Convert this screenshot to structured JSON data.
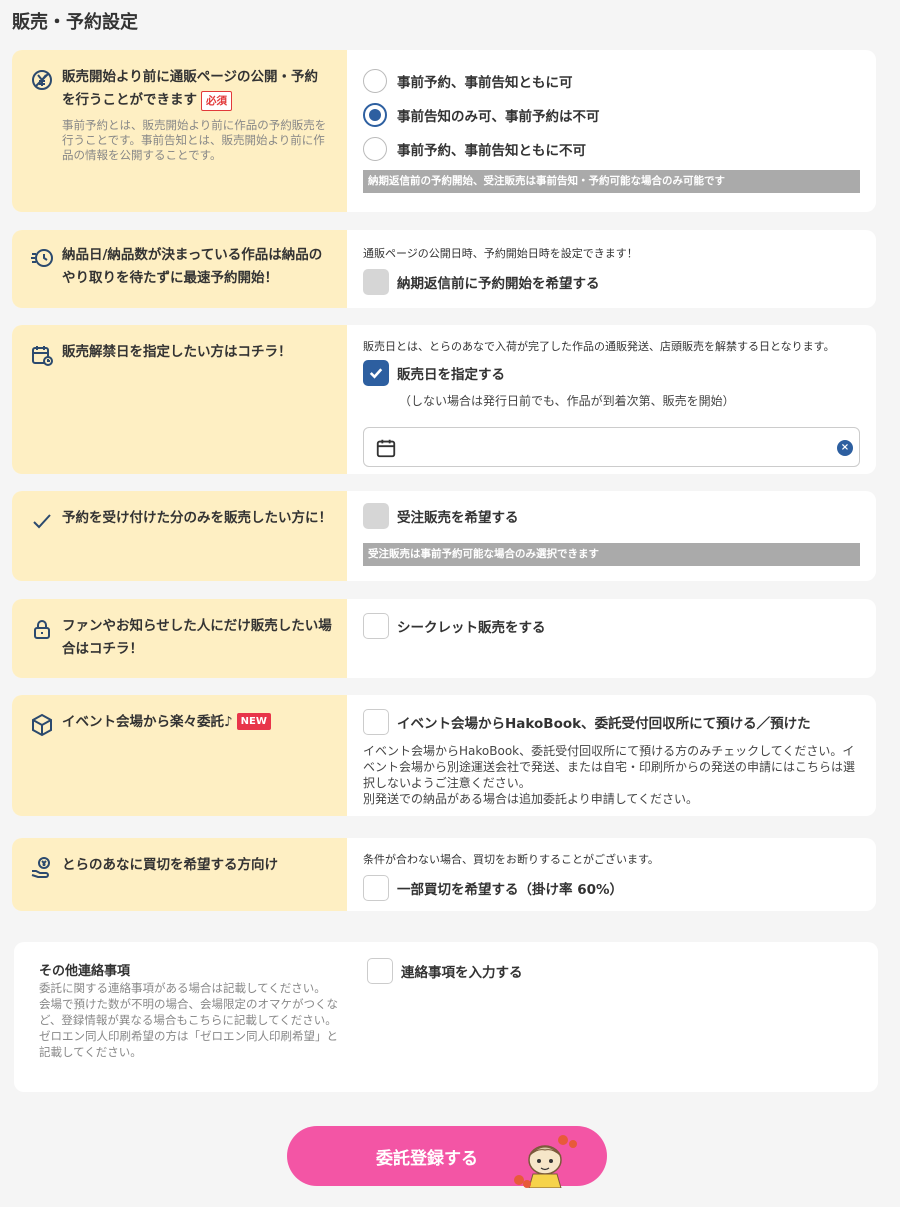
{
  "page_title": "販売・予約設定",
  "sections": {
    "reserve": {
      "heading_line1": "販売開始より前に通販ページの公開・予約",
      "heading_line2": "を行うことができます",
      "required_badge": "必須",
      "desc": "事前予約とは、販売開始より前に作品の予約販売を行うことです。事前告知とは、販売開始より前に作品の情報を公開することです。",
      "options": [
        {
          "label": "事前予約、事前告知ともに可",
          "selected": false
        },
        {
          "label": "事前告知のみ可、事前予約は不可",
          "selected": true
        },
        {
          "label": "事前予約、事前告知ともに不可",
          "selected": false
        }
      ],
      "note": "納期返信前の予約開始、受注販売は事前告知・予約可能な場合のみ可能です"
    },
    "early": {
      "heading": "納品日/納品数が決まっている作品は納品のやり取りを待たずに最速予約開始！",
      "info": "通販ページの公開日時、予約開始日時を設定できます！",
      "checkbox_label": "納期返信前に予約開始を希望する"
    },
    "release": {
      "heading": "販売解禁日を指定したい方はコチラ！",
      "info": "販売日とは、とらのあなで入荷が完了した作品の通販発送、店頭販売を解禁する日となります。",
      "checkbox_label": "販売日を指定する",
      "sub_note": "（しない場合は発行日前でも、作品が到着次第、販売を開始）",
      "date_value": "",
      "clear_label": "×"
    },
    "order": {
      "heading": "予約を受け付けた分のみを販売したい方に！",
      "checkbox_label": "受注販売を希望する",
      "note": "受注販売は事前予約可能な場合のみ選択できます"
    },
    "secret": {
      "heading": "ファンやお知らせした人にだけ販売したい場合はコチラ！",
      "checkbox_label": "シークレット販売をする"
    },
    "event": {
      "heading": "イベント会場から楽々委託♪",
      "new_badge": "NEW",
      "checkbox_label": "イベント会場からHakoBook、委託受付回収所にて預ける／預けた",
      "desc1": "イベント会場からHakoBook、委託受付回収所にて預ける方のみチェックしてください。イベント会場から別途運送会社で発送、または自宅・印刷所からの発送の申請にはこちらは選択しないようご注意ください。",
      "desc2": "別発送での納品がある場合は追加委託より申請してください。"
    },
    "buyout": {
      "heading": "とらのあなに買切を希望する方向け",
      "info": "条件が合わない場合、買切をお断りすることがございます。",
      "checkbox_label": "一部買切を希望する（掛け率 60%）"
    }
  },
  "other": {
    "heading": "その他連絡事項",
    "desc": "委託に関する連絡事項がある場合は記載してください。\n会場で預けた数が不明の場合、会場限定のオマケがつくなど、登録情報が異なる場合もこちらに記載してください。\nゼロエン同人印刷希望の方は「ゼロエン同人印刷希望」と記載してください。",
    "checkbox_label": "連絡事項を入力する"
  },
  "submit_label": "委託登録する",
  "colors": {
    "accent": "#2d5fa0",
    "left_panel": "#feefc3",
    "submit": "#f355a5",
    "badge_red": "#e8354a"
  }
}
